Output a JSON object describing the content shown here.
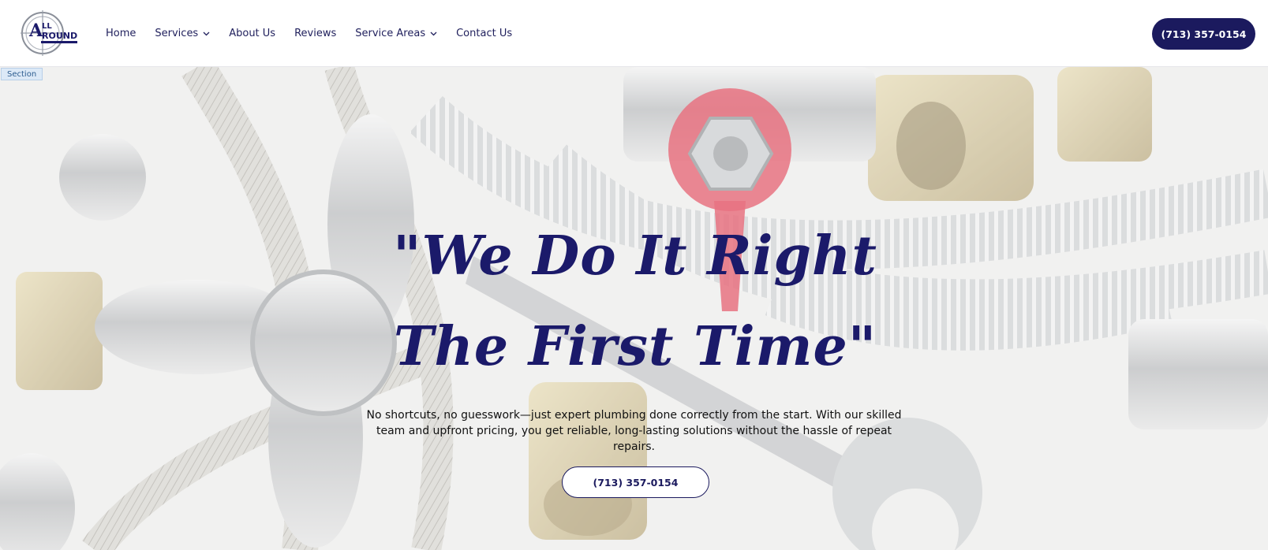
{
  "header": {
    "logo_text": "ALL AROUND",
    "nav": [
      {
        "label": "Home"
      },
      {
        "label": "Services"
      },
      {
        "label": "About Us"
      },
      {
        "label": "Reviews"
      },
      {
        "label": "Service Areas"
      },
      {
        "label": "Contact Us"
      }
    ],
    "phone_label": "(713) 357-0154"
  },
  "hero": {
    "section_tag": "Section",
    "headline_line1": "\"We Do It Right",
    "headline_line2": "The First Time\"",
    "subtext": "No shortcuts, no guesswork—just expert plumbing done correctly from the start. With our skilled team and upfront pricing, you get reliable, long-lasting solutions without the hassle of repeat repairs.",
    "cta_label": "(713) 357-0154"
  },
  "colors": {
    "brand_navy": "#1b1a5e",
    "valve_red": "#e2354a"
  }
}
